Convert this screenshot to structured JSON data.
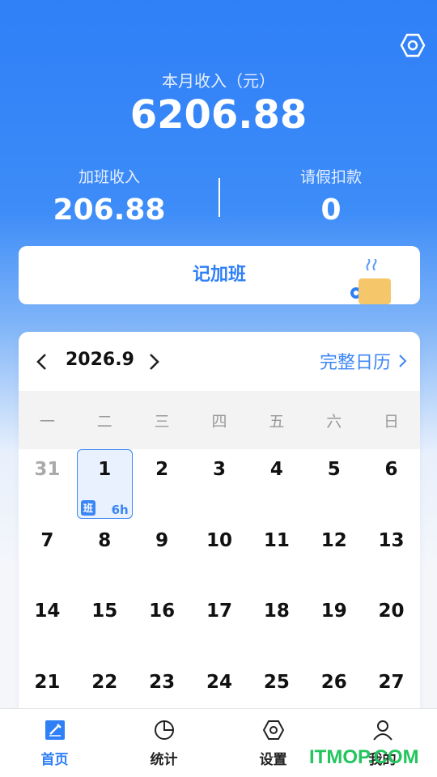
{
  "header": {
    "month_income_label": "本月收入（元）",
    "month_income_value": "6206.88",
    "overtime_label": "加班收入",
    "overtime_value": "206.88",
    "leave_label": "请假扣款",
    "leave_value": "0",
    "settings_icon": "hexagon-settings-icon"
  },
  "record_button": {
    "label": "记加班",
    "illustration": "coffee-cup-icon"
  },
  "calendar": {
    "month": "2026.9",
    "full_calendar_label": "完整日历",
    "weekdays": [
      "一",
      "二",
      "三",
      "四",
      "五",
      "六",
      "日"
    ],
    "days": [
      {
        "num": "31",
        "muted": true
      },
      {
        "num": "1",
        "selected": true,
        "tag": "班",
        "hours": "6h"
      },
      {
        "num": "2"
      },
      {
        "num": "3"
      },
      {
        "num": "4"
      },
      {
        "num": "5"
      },
      {
        "num": "6"
      },
      {
        "num": "7"
      },
      {
        "num": "8"
      },
      {
        "num": "9"
      },
      {
        "num": "10"
      },
      {
        "num": "11"
      },
      {
        "num": "12"
      },
      {
        "num": "13"
      },
      {
        "num": "14"
      },
      {
        "num": "15"
      },
      {
        "num": "16"
      },
      {
        "num": "17"
      },
      {
        "num": "18"
      },
      {
        "num": "19"
      },
      {
        "num": "20"
      },
      {
        "num": "21"
      },
      {
        "num": "22"
      },
      {
        "num": "23"
      },
      {
        "num": "24"
      },
      {
        "num": "25"
      },
      {
        "num": "26"
      },
      {
        "num": "27"
      }
    ]
  },
  "tabbar": {
    "tabs": [
      {
        "label": "首页",
        "icon": "edit-icon",
        "active": true
      },
      {
        "label": "统计",
        "icon": "pie-chart-icon"
      },
      {
        "label": "设置",
        "icon": "hexagon-settings-icon"
      },
      {
        "label": "我的",
        "icon": "user-icon"
      }
    ]
  },
  "watermark": "ITMOP.COM",
  "colors": {
    "primary": "#2f7ff7",
    "accent": "#3b86f5",
    "cup": "#f6c76a"
  }
}
